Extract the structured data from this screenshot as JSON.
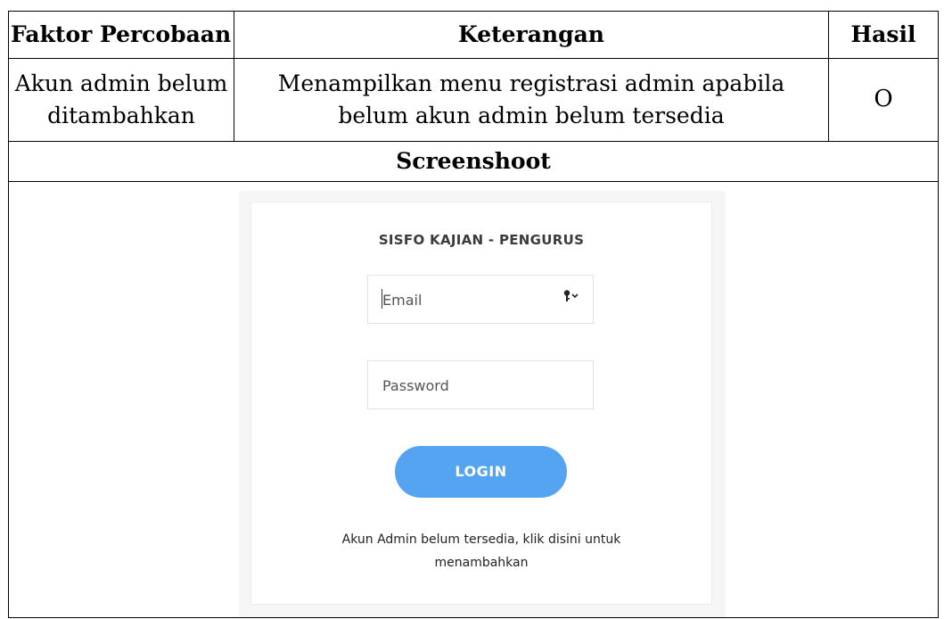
{
  "table": {
    "headers": [
      "Faktor Percobaan",
      "Keterangan",
      "Hasil"
    ],
    "row": {
      "faktor_line1": "Akun admin belum",
      "faktor_line2": "ditambahkan",
      "keterangan_line1": "Menampilkan menu registrasi admin apabila",
      "keterangan_line2": "belum akun admin belum tersedia",
      "hasil": "O"
    },
    "screenshot_header": "Screenshoot"
  },
  "screenshot": {
    "brand_title": "SISFO KAJIAN - PENGURUS",
    "email_placeholder": "Email",
    "email_icon": "key-icon",
    "password_placeholder": "Password",
    "login_label": "LOGIN",
    "help_line1": "Akun Admin belum tersedia, klik disini untuk",
    "help_line2": "menambahkan",
    "colors": {
      "button": "#55a4f2"
    }
  }
}
